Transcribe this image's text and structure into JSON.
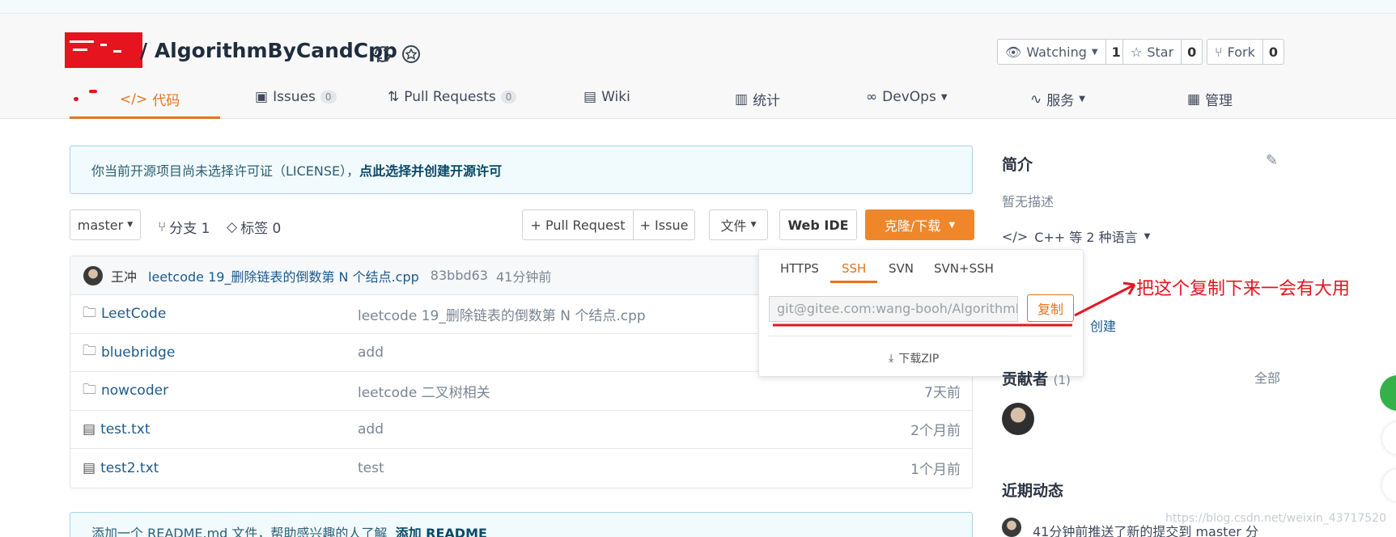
{
  "repo": {
    "title": "/ AlgorithmByCandCpp"
  },
  "header_buttons": [
    {
      "label": "Watching",
      "count": "1"
    },
    {
      "label": "Star",
      "count": "0"
    },
    {
      "label": "Fork",
      "count": "0"
    }
  ],
  "nav": {
    "code": "代码",
    "issues": "Issues",
    "issues_count": "0",
    "pulls": "Pull Requests",
    "pulls_count": "0",
    "wiki": "Wiki",
    "stats": "统计",
    "devops": "DevOps",
    "services": "服务",
    "manage": "管理"
  },
  "license": {
    "text": "你当前开源项目尚未选择许可证（LICENSE），",
    "link": "点此选择并创建开源许可"
  },
  "toolbar": {
    "branch": "master",
    "branches": "分支 1",
    "tags": "标签 0",
    "pull_request": "+ Pull Request",
    "issue": "+ Issue",
    "file": "文件",
    "web_ide": "Web IDE",
    "clone": "克隆/下载"
  },
  "commit": {
    "author": "王冲",
    "message": "leetcode 19_删除链表的倒数第 N 个结点.cpp",
    "hash": "83bbd63",
    "time": "41分钟前"
  },
  "files": [
    {
      "name": "LeetCode",
      "type": "folder",
      "message": "leetcode 19_删除链表的倒数第 N 个结点.cpp",
      "time": ""
    },
    {
      "name": "bluebridge",
      "type": "folder",
      "message": "add",
      "time": ""
    },
    {
      "name": "nowcoder",
      "type": "folder",
      "message": "leetcode 二叉树相关",
      "time": "7天前"
    },
    {
      "name": "test.txt",
      "type": "file",
      "message": "add",
      "time": "2个月前"
    },
    {
      "name": "test2.txt",
      "type": "file",
      "message": "test",
      "time": "1个月前"
    }
  ],
  "clone_dropdown": {
    "tabs": [
      "HTTPS",
      "SSH",
      "SVN",
      "SVN+SSH"
    ],
    "active_tab": "SSH",
    "url": "git@gitee.com:wang-booh/AlgorithmByCandCpp.git",
    "copy": "复制",
    "download_zip": "下载ZIP"
  },
  "sidebar": {
    "intro_title": "简介",
    "intro_desc": "暂无描述",
    "languages": "C++ 等 2 种语言",
    "create": "创建",
    "contributors_title": "贡献者",
    "contributors_count": "(1)",
    "all": "全部",
    "activity_title": "近期动态",
    "activity_text": "41分钟前推送了新的提交到 master 分"
  },
  "readme": {
    "text": "添加一个 README.md 文件，帮助感兴趣的人了解",
    "link": "添加 README"
  },
  "annotation": "把这个复制下来一会有大用",
  "watermark": "https://blog.csdn.net/weixin_43717520",
  "colors": {
    "accent": "#e8731c",
    "annotation": "#e5141f",
    "link": "#1d5a8c"
  }
}
